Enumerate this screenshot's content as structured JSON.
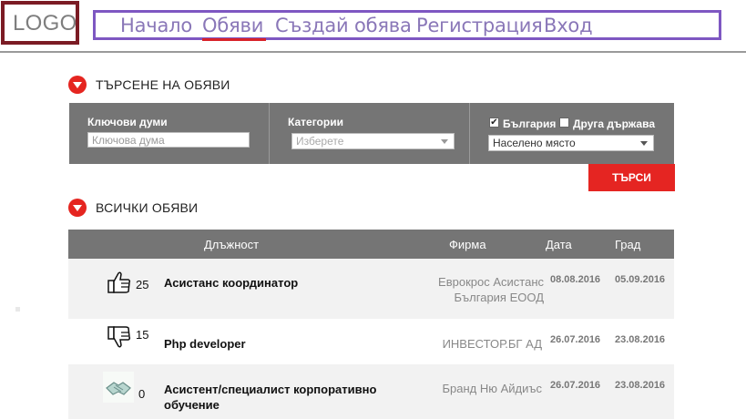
{
  "header": {
    "logo": "LOGO",
    "nav": [
      {
        "label": "Начало"
      },
      {
        "label": "Обяви"
      },
      {
        "label": "Създай обява"
      },
      {
        "label": "Регистрация"
      },
      {
        "label": "Вход"
      }
    ],
    "active_nav": "Обяви"
  },
  "search": {
    "title": "ТЪРСЕНЕ НА ОБЯВИ",
    "keywords_label": "Ключови думи",
    "keywords_placeholder": "Ключова дума",
    "categories_label": "Категории",
    "categories_selected": "Изберете",
    "country_bulgaria_label": "България",
    "country_bulgaria_checked": true,
    "country_other_label": "Друга държава",
    "country_other_checked": false,
    "place_selected": "Населено място",
    "submit_label": "ТЪРСИ"
  },
  "listings": {
    "title": "ВСИЧКИ ОБЯВИ",
    "columns": {
      "position": "Длъжност",
      "firm": "Фирма",
      "date": "Дата",
      "city": "Град"
    },
    "rows": [
      {
        "icon": "thumbs-up-icon",
        "score": "25",
        "title": "Асистанс координатор",
        "firm": "Еврокрос Асистанс България ЕООД",
        "date": "08.08.2016",
        "city": "05.09.2016"
      },
      {
        "icon": "thumbs-down-icon",
        "score": "15",
        "title": "Php developer",
        "firm": "ИНВЕСТОР.БГ АД",
        "date": "26.07.2016",
        "city": "23.08.2016"
      },
      {
        "icon": "handshake-icon",
        "score": "0",
        "title": "Асистент/специалист корпоративно обучение",
        "firm": "Бранд Ню Айдиъс",
        "date": "26.07.2016",
        "city": "23.08.2016"
      }
    ]
  },
  "colors": {
    "brand_red": "#e52520",
    "nav_purple": "#7e57c2",
    "logo_border": "#7b1b24",
    "panel_gray": "#757575"
  }
}
